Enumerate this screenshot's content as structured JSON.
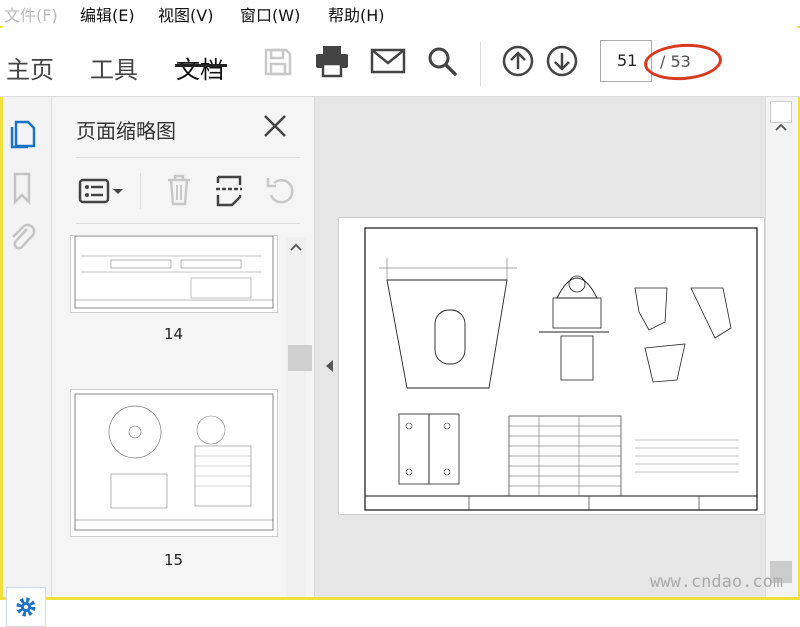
{
  "menu": [
    "文件(F)",
    "编辑(E)",
    "视图(V)",
    "窗口(W)",
    "帮助(H)"
  ],
  "tabs": [
    "主页",
    "工具",
    "文档"
  ],
  "toolbar": {
    "page_current": "51",
    "page_total": "/ 53"
  },
  "panel": {
    "title": "页面缩略图",
    "thumbs": [
      "14",
      "15"
    ]
  },
  "watermark": "www.cndao.com",
  "colors": {
    "accent": "#1a73c8",
    "annotation": "#d93a1e",
    "frame": "#f2e13c"
  }
}
